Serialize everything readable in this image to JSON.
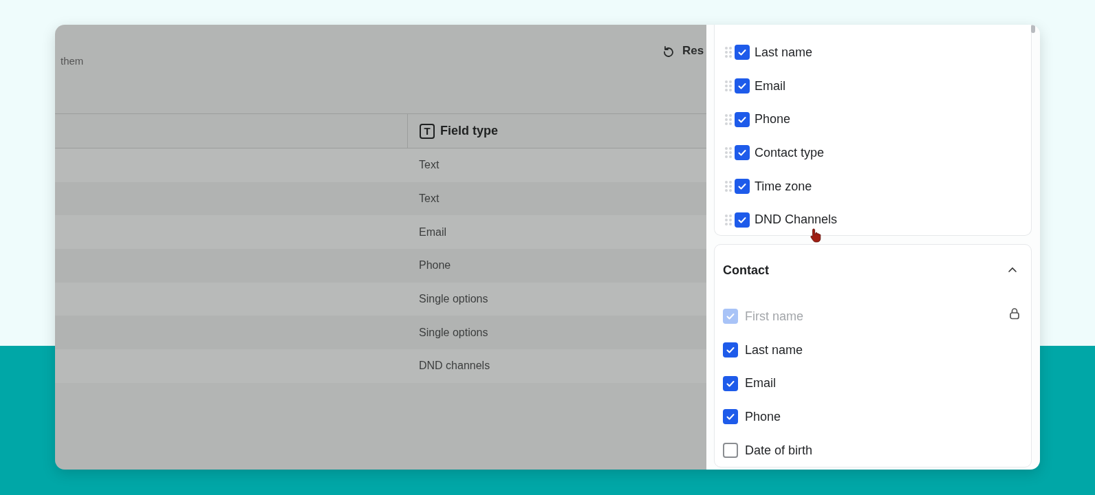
{
  "toolbar": {
    "hint": "them",
    "reset_button": "Res"
  },
  "table": {
    "columns": [
      {
        "label": "Field type",
        "icon_letter": "T"
      }
    ],
    "rows": [
      "Text",
      "Text",
      "Email",
      "Phone",
      "Single options",
      "Single options",
      "DND channels"
    ]
  },
  "panel": {
    "groups": [
      {
        "reorderable": true,
        "items": [
          {
            "label": "Last name",
            "checked": true,
            "disabled": false,
            "locked": false
          },
          {
            "label": "Email",
            "checked": true,
            "disabled": false,
            "locked": false
          },
          {
            "label": "Phone",
            "checked": true,
            "disabled": false,
            "locked": false
          },
          {
            "label": "Contact type",
            "checked": true,
            "disabled": false,
            "locked": false
          },
          {
            "label": "Time zone",
            "checked": true,
            "disabled": false,
            "locked": false
          },
          {
            "label": "DND Channels",
            "checked": true,
            "disabled": false,
            "locked": false
          }
        ]
      },
      {
        "title": "Contact",
        "reorderable": false,
        "expanded": true,
        "items": [
          {
            "label": "First name",
            "checked": true,
            "disabled": true,
            "locked": true
          },
          {
            "label": "Last name",
            "checked": true,
            "disabled": false,
            "locked": false
          },
          {
            "label": "Email",
            "checked": true,
            "disabled": false,
            "locked": false
          },
          {
            "label": "Phone",
            "checked": true,
            "disabled": false,
            "locked": false
          },
          {
            "label": "Date of birth",
            "checked": false,
            "disabled": false,
            "locked": false
          }
        ]
      }
    ]
  }
}
